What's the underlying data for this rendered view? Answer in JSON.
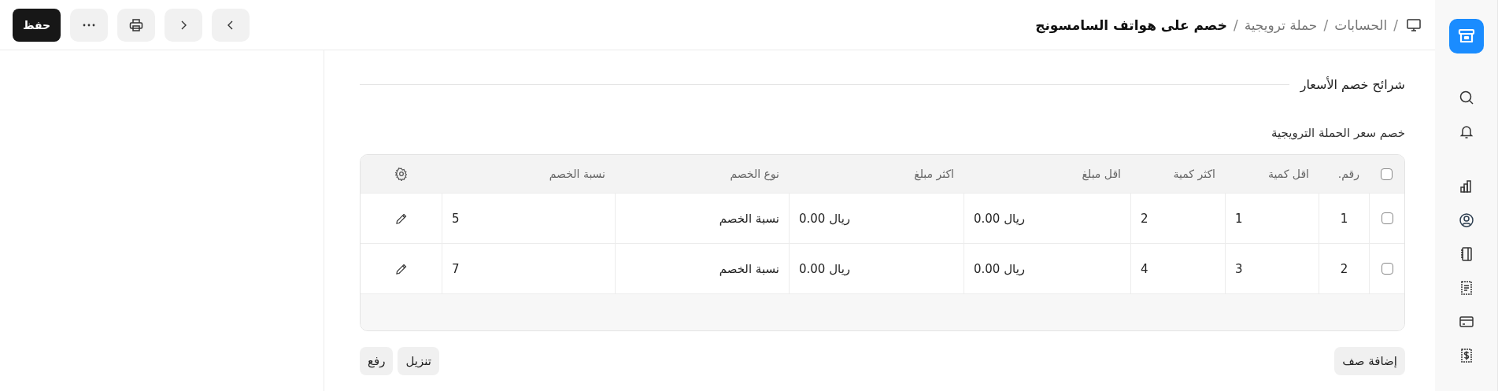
{
  "breadcrumb": [
    {
      "label": "الحسابات",
      "separator": "/",
      "current": false
    },
    {
      "label": "حملة ترويجية",
      "separator": "/",
      "current": false
    },
    {
      "label": "خصم على هواتف السامسونج",
      "separator": "/",
      "current": true
    }
  ],
  "save_button": "حفظ",
  "section": {
    "title": "شرائح خصم الأسعار"
  },
  "table": {
    "title": "خصم سعر الحملة الترويجية",
    "select_all_checked": false,
    "columns": [
      {
        "label": "رقم.",
        "kind": "index"
      },
      {
        "label": "اقل كمية",
        "kind": "number"
      },
      {
        "label": "اكثر كمية",
        "kind": "number"
      },
      {
        "label": "اقل مبلغ",
        "kind": "number"
      },
      {
        "label": "اكثر مبلغ",
        "kind": "number"
      },
      {
        "label": "نوع الخصم",
        "kind": "text"
      },
      {
        "label": "نسبة الخصم",
        "kind": "number"
      }
    ],
    "rows": [
      {
        "checked": false,
        "cells": [
          "1",
          "1",
          "2",
          "ريال 0.00",
          "ريال 0.00",
          "نسبة الخصم",
          "5"
        ]
      },
      {
        "checked": false,
        "cells": [
          "2",
          "3",
          "4",
          "ريال 0.00",
          "ريال 0.00",
          "نسبة الخصم",
          "7"
        ]
      }
    ]
  },
  "row_actions": {
    "add": "إضافة صف",
    "download": "تنزيل",
    "upload": "رفع"
  }
}
